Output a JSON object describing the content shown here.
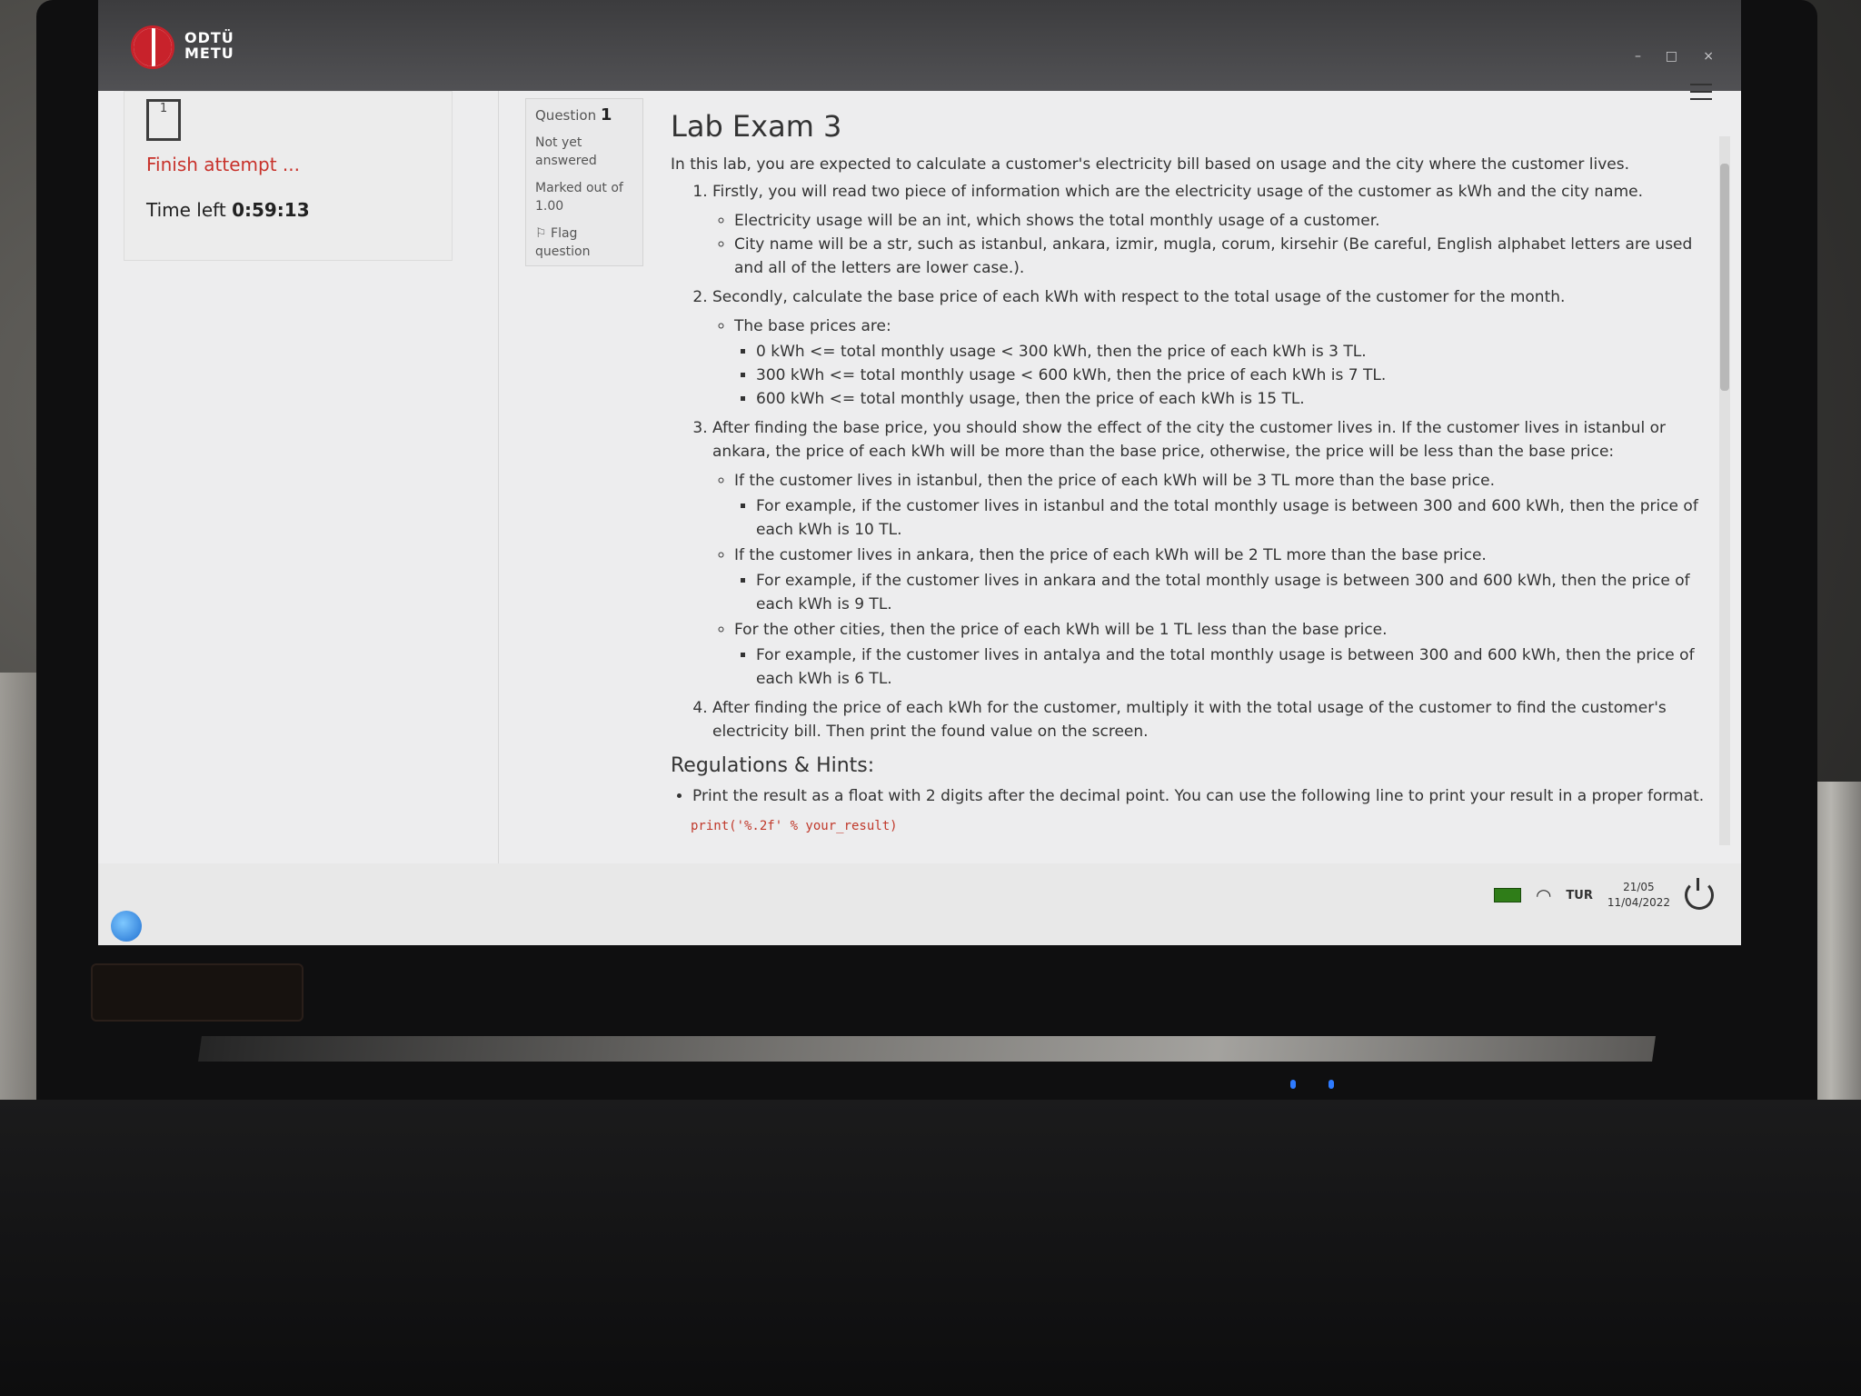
{
  "brand": {
    "logo_text_line1": "ODTÜ",
    "logo_text_line2": "METU"
  },
  "window": {
    "minimize": "–",
    "maximize": "□",
    "close": "×"
  },
  "nav": {
    "question_number": "1",
    "finish_attempt": "Finish attempt ...",
    "time_left_label": "Time left",
    "time_left_value": "0:59:13"
  },
  "question_info": {
    "label": "Question",
    "number": "1",
    "status_line1": "Not yet",
    "status_line2": "answered",
    "marked_line1": "Marked out of",
    "marked_line2": "1.00",
    "flag": "Flag question"
  },
  "content": {
    "title": "Lab Exam 3",
    "intro": "In this lab, you are expected to calculate a customer's electricity bill based on usage and the city where the customer lives.",
    "step1": "Firstly, you will read two piece of information which are the electricity usage of the customer as kWh and the city name.",
    "step1_a": "Electricity usage will be an int, which shows the total monthly usage of a customer.",
    "step1_b": "City name will be a str, such as istanbul, ankara, izmir, mugla, corum, kirsehir (Be careful, English alphabet letters are used and all of the letters are lower case.).",
    "step2": "Secondly, calculate the base price of each kWh with respect to the total usage of the customer for the month.",
    "step2_a": "The base prices are:",
    "step2_p1": "0 kWh <= total monthly usage < 300 kWh, then the price of each kWh is 3 TL.",
    "step2_p2": "300 kWh <= total monthly usage < 600 kWh, then the price of each kWh is 7 TL.",
    "step2_p3": "600 kWh <= total monthly usage, then the price of each kWh is 15 TL.",
    "step3": "After finding the base price, you should show the effect of the city the customer lives in. If the customer lives in istanbul or ankara, the price of each kWh will be more than the base price, otherwise, the price will be less than the base price:",
    "step3_a": "If the customer lives in istanbul, then the price of each kWh will be 3 TL more than the base price.",
    "step3_a_ex": "For example, if the customer lives in istanbul and the total monthly usage is between 300 and 600 kWh, then the price of each kWh is 10 TL.",
    "step3_b": "If the customer lives in ankara, then the price of each kWh will be 2 TL more than the base price.",
    "step3_b_ex": "For example, if the customer lives in ankara and the total monthly usage is between 300 and 600 kWh, then the price of each kWh is 9 TL.",
    "step3_c": "For the other cities, then the price of each kWh will be 1 TL less than the base price.",
    "step3_c_ex": "For example, if the customer lives in antalya and the total monthly usage is between 300 and 600 kWh, then the price of each kWh is 6 TL.",
    "step4": "After finding the price of each kWh for the customer, multiply it with the total usage of the customer to find the customer's electricity bill. Then print the found value on the screen.",
    "hints_title": "Regulations & Hints:",
    "hint1": "Print the result as a float with 2 digits after the decimal point. You can use the following line to print your result in a proper format.",
    "code": "print('%.2f' % your_result)"
  },
  "taskbar": {
    "language": "TUR",
    "time": "21/05",
    "date": "11/04/2022"
  },
  "colors": {
    "accent_red": "#c8322b",
    "topbar": "#3c3c3e",
    "code_red": "#c0392b"
  }
}
